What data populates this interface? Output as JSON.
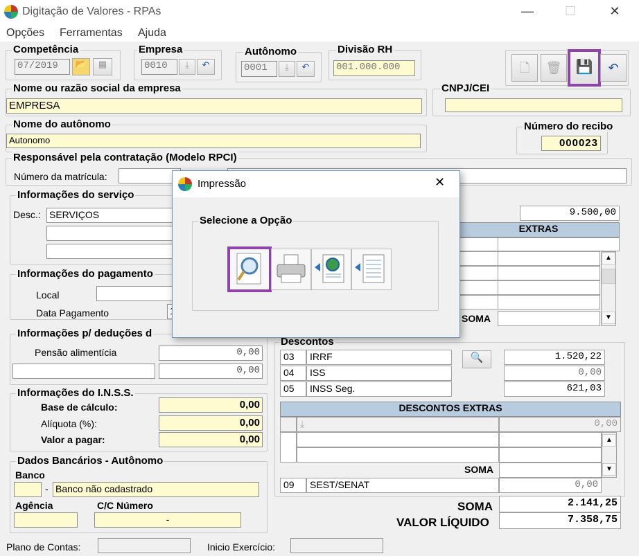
{
  "window": {
    "title": "Digitação de Valores - RPAs",
    "minimize": "—",
    "maximize": "☐",
    "close": "✕"
  },
  "menu": [
    "Opções",
    "Ferramentas",
    "Ajuda"
  ],
  "competencia": {
    "label": "Competência",
    "value": "07/2019"
  },
  "empresa": {
    "label": "Empresa",
    "value": "0010"
  },
  "autonomo": {
    "label": "Autônomo",
    "value": "0001"
  },
  "divisao": {
    "label": "Divisão RH",
    "value": "001.000.000"
  },
  "razao": {
    "label": "Nome ou razão social da empresa",
    "value": "EMPRESA"
  },
  "cnpj": {
    "label": "CNPJ/CEI",
    "value": ""
  },
  "nome_autonomo": {
    "label": "Nome do autônomo",
    "value": "Autonomo"
  },
  "recibo": {
    "label": "Número do recibo",
    "value": "000023"
  },
  "responsavel": {
    "label": "Responsável pela contratação (Modelo RPCI)",
    "matricula_label": "Número da matrícula:"
  },
  "servico": {
    "label": "Informações do serviço",
    "desc_label": "Desc.:",
    "desc_value": "SERVIÇOS"
  },
  "pagamento": {
    "label": "Informações do pagamento",
    "local_label": "Local",
    "data_label": "Data Pagamento",
    "data_value": "1"
  },
  "deducoes": {
    "label": "Informações p/ deduções d",
    "pensao_label": "Pensão alimentícia",
    "pensao_value": "0,00",
    "outra_value": "0,00"
  },
  "inss": {
    "label": "Informações do I.N.S.S.",
    "base_label": "Base de cálculo:",
    "base_value": "0,00",
    "aliquota_label": "Alíquota (%):",
    "aliquota_value": "0,00",
    "valor_label": "Valor a pagar:",
    "valor_value": "0,00"
  },
  "bancarios": {
    "label": "Dados Bancários - Autônomo",
    "banco_label": "Banco",
    "banco_value": "Banco não cadastrado",
    "agencia_label": "Agência",
    "cc_label": "C/C Número",
    "cc_value": "-"
  },
  "proventos": {
    "total": "9.500,00",
    "extras_header": "EXTRAS",
    "soma_label": "SOMA"
  },
  "descontos": {
    "label": "Descontos",
    "rows": [
      {
        "code": "03",
        "name": "IRRF",
        "value": "1.520,22"
      },
      {
        "code": "04",
        "name": "ISS",
        "value": "0,00"
      },
      {
        "code": "05",
        "name": "INSS Seg.",
        "value": "621,03"
      }
    ],
    "extras_header": "DESCONTOS EXTRAS",
    "extras_value": "0,00",
    "soma_label": "SOMA",
    "sest": {
      "code": "09",
      "name": "SEST/SENAT",
      "value": "0,00"
    }
  },
  "totais": {
    "soma_label": "SOMA",
    "soma_value": "2.141,25",
    "liquido_label": "VALOR LÍQUIDO",
    "liquido_value": "7.358,75"
  },
  "footer": {
    "plano_label": "Plano de Contas:",
    "inicio_label": "Inicio Exercício:"
  },
  "dialog": {
    "title": "Impressão",
    "group_label": "Selecione a Opção",
    "close": "✕"
  },
  "colors": {
    "highlight": "#8e44ad",
    "yellow_field": "#fffbd0",
    "header_blue": "#b8cce0"
  }
}
